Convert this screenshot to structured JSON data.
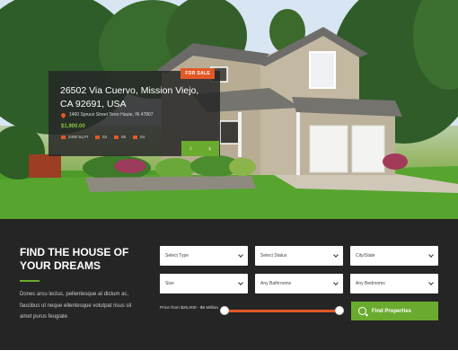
{
  "listing": {
    "badge": "FOR SALE",
    "title": "26502 Via Cuervo, Mission Viejo, CA 92691, USA",
    "address": "1460 Spruce Street Terre Haute, IN 47807",
    "price": "$1,900.00",
    "specs": [
      {
        "icon": "area-icon",
        "value": "2400 Sq Ft"
      },
      {
        "icon": "garage-icon",
        "value": "03"
      },
      {
        "icon": "bath-icon",
        "value": "05"
      },
      {
        "icon": "bed-icon",
        "value": "04"
      }
    ],
    "nav": {
      "prev": "‹",
      "next": "›"
    }
  },
  "search": {
    "title": "FIND THE HOUSE OF YOUR DREAMS",
    "description": "Donec arcu lectus, pellentesque at dictum ac, faucibus ut neque ellentesque volutpat risus sit amet purus feugiate",
    "fields": {
      "type": "Select Type",
      "status": "Select Status",
      "city": "City/State",
      "size": "Size",
      "bathrooms": "Any Bathrooms",
      "bedrooms": "Any Bedrooms"
    },
    "price_label": "Price from $25,000 - $5 Million",
    "price_range": {
      "min_fraction": 0.0,
      "max_fraction": 1.0
    },
    "button_label": "Find Properties"
  },
  "colors": {
    "accent_green": "#6aab2f",
    "accent_orange": "#e25826",
    "panel_bg": "#252525"
  }
}
